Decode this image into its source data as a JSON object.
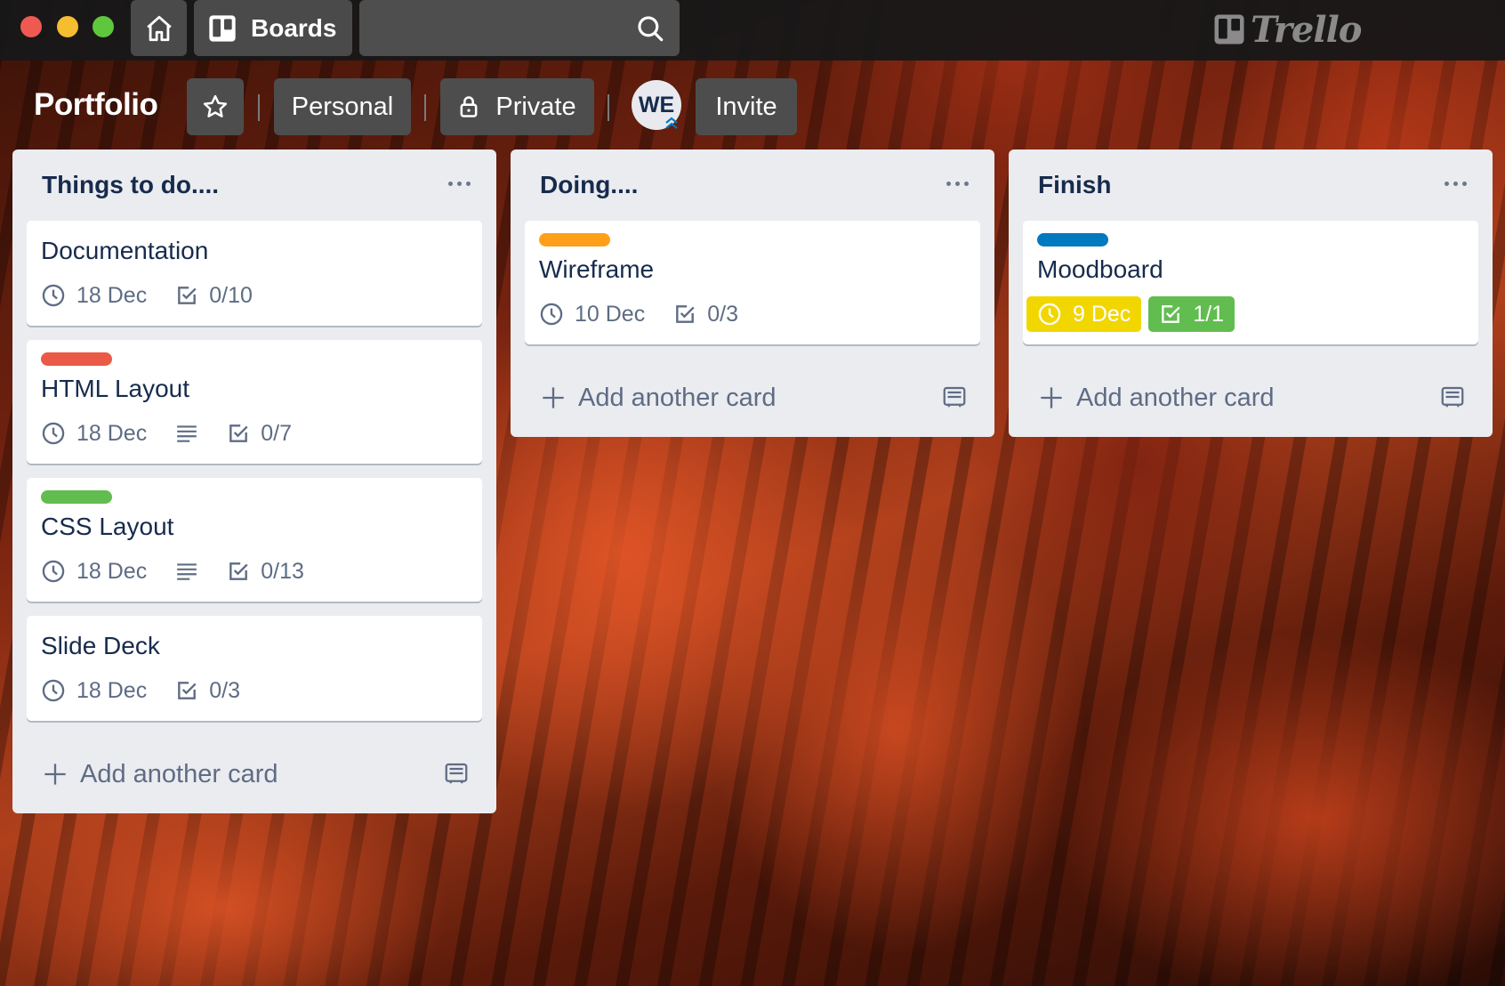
{
  "window": {
    "traffic_lights": [
      "close",
      "minimize",
      "maximize"
    ]
  },
  "topbar": {
    "home_icon": "house-icon",
    "boards_label": "Boards",
    "search_placeholder": "",
    "logo_text": "Trello"
  },
  "board": {
    "title": "Portfolio",
    "visibility_team": "Personal",
    "visibility": "Private",
    "member_initials": "WE",
    "invite_label": "Invite"
  },
  "colors": {
    "label_red": "#eb5a46",
    "label_green": "#61bd4f",
    "label_orange": "#ff9f1a",
    "label_blue": "#0079bf",
    "due_yellow": "#f2d600",
    "complete_green": "#61bd4f"
  },
  "lists": [
    {
      "title": "Things to do....",
      "cards": [
        {
          "title": "Documentation",
          "due": "18 Dec",
          "checklist": "0/10"
        },
        {
          "title": "HTML Layout",
          "label": "red",
          "due": "18 Dec",
          "checklist": "0/7",
          "has_description": true
        },
        {
          "title": "CSS Layout",
          "label": "green",
          "due": "18 Dec",
          "checklist": "0/13",
          "has_description": true
        },
        {
          "title": "Slide Deck",
          "due": "18 Dec",
          "checklist": "0/3"
        }
      ],
      "add_card_label": "Add another card"
    },
    {
      "title": "Doing....",
      "cards": [
        {
          "title": "Wireframe",
          "label": "orange",
          "due": "10 Dec",
          "checklist": "0/3"
        }
      ],
      "add_card_label": "Add another card"
    },
    {
      "title": "Finish",
      "cards": [
        {
          "title": "Moodboard",
          "label": "blue",
          "due": "9 Dec",
          "checklist": "1/1",
          "due_status": "due-soon",
          "checklist_complete": true
        }
      ],
      "add_card_label": "Add another card"
    }
  ]
}
